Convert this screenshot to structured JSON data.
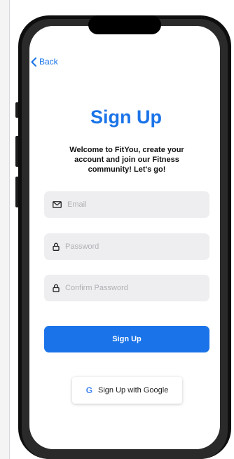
{
  "nav": {
    "back_label": "Back"
  },
  "header": {
    "title": "Sign Up",
    "subtitle": "Welcome to FitYou, create your account and join our Fitness community! Let's go!"
  },
  "form": {
    "email": {
      "placeholder": "Email",
      "value": ""
    },
    "password": {
      "placeholder": "Password",
      "value": ""
    },
    "confirm_password": {
      "placeholder": "Confirm Password",
      "value": ""
    },
    "submit_label": "Sign Up",
    "google_label": "Sign Up with Google",
    "google_letter": "G"
  },
  "colors": {
    "accent": "#1a73e8",
    "field_bg": "#eeeef0",
    "text": "#111111"
  },
  "icons": {
    "back": "chevron-left-icon",
    "email": "envelope-icon",
    "password": "lock-icon",
    "google": "google-icon"
  }
}
